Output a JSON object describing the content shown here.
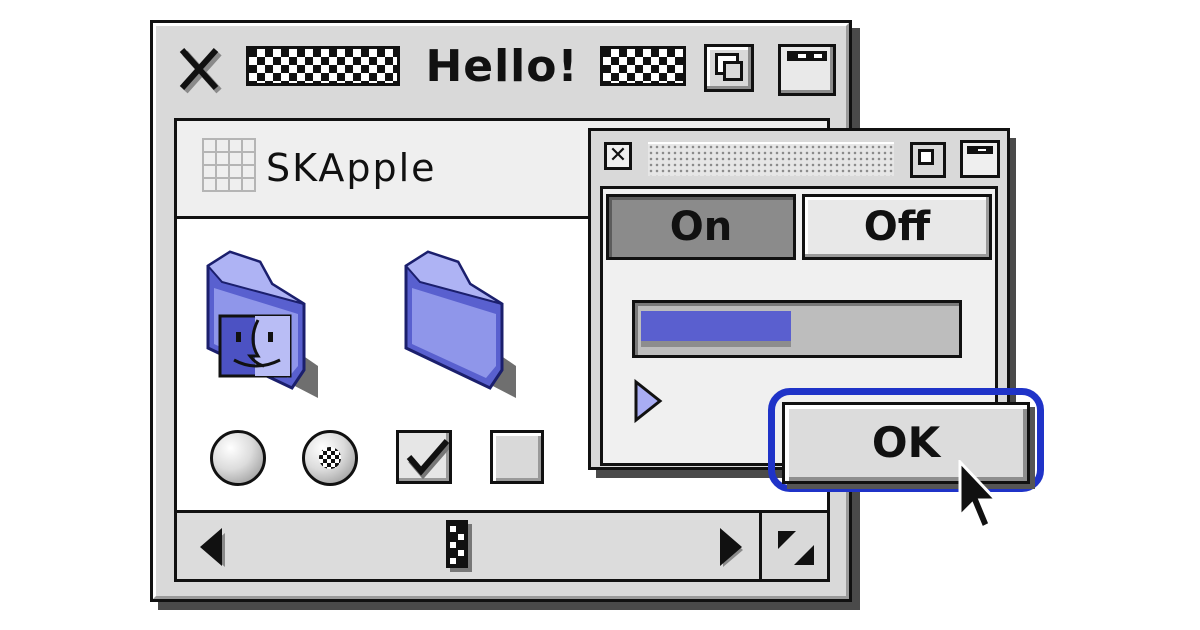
{
  "main_window": {
    "title": "Hello!",
    "content_header_label": "SKApple",
    "controls": {
      "radio_unselected": false,
      "radio_selected": true,
      "checkbox_checked": true,
      "checkbox_unchecked": false
    },
    "icons": [
      "close-icon",
      "zoom-icon",
      "windowshade-icon",
      "grid-icon",
      "finder-folder-icon",
      "folder-icon",
      "scroll-left-arrow-icon",
      "scroll-right-arrow-icon",
      "grow-box-icon"
    ]
  },
  "dialog": {
    "segments": [
      {
        "label": "On",
        "selected": true
      },
      {
        "label": "Off",
        "selected": false
      }
    ],
    "progress_fraction": 0.48,
    "ok_label": "OK"
  },
  "colors": {
    "accent_blue": "#1f33c8",
    "progress_fill": "#5a5fcf",
    "folder_blue": "#8f96ea",
    "window_gray": "#d9d9d9"
  }
}
